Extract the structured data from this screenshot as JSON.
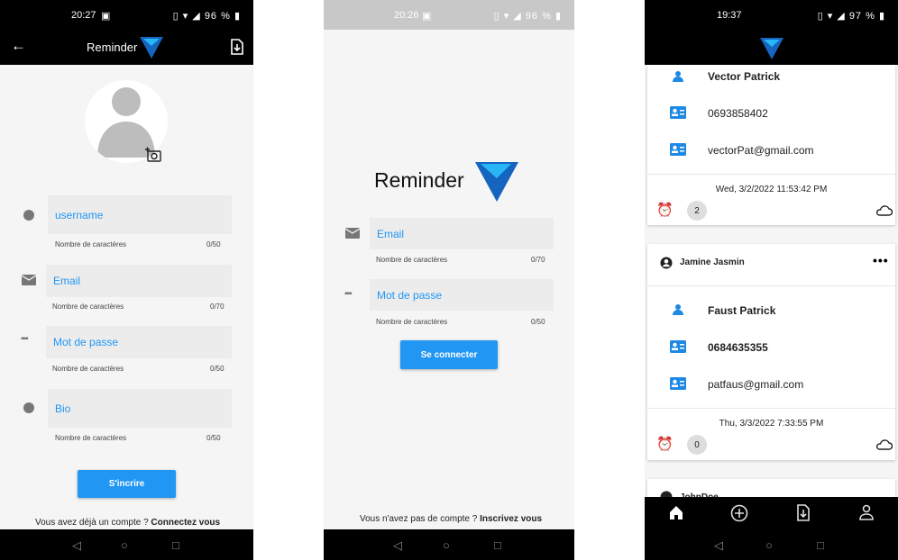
{
  "colors": {
    "accent": "#2196f3",
    "logo_dark": "#1565c0",
    "logo_light": "#29b6f6",
    "bar": "#000000"
  },
  "signup": {
    "status_time": "20:27",
    "status_battery": "96 %",
    "title": "Reminder",
    "fields": [
      {
        "placeholder": "username",
        "hint": "Nombre de caractères",
        "counter": "0/50"
      },
      {
        "placeholder": "Email",
        "hint": "Nombre de caractères",
        "counter": "0/70"
      },
      {
        "placeholder": "Mot de passe",
        "hint": "Nombre de caractères",
        "counter": "0/50"
      },
      {
        "placeholder": "Bio",
        "hint": "Nombre de caractères",
        "counter": "0/50"
      }
    ],
    "submit_label": "S'incrire",
    "footer_text": "Vous avez déjà un compte ?",
    "footer_link": "Connectez vous"
  },
  "login": {
    "status_time": "20:26",
    "status_battery": "96 %",
    "logo_text": "Reminder",
    "fields": [
      {
        "placeholder": "Email",
        "hint": "Nombre de caractères",
        "counter": "0/70"
      },
      {
        "placeholder": "Mot de passe",
        "hint": "Nombre de caractères",
        "counter": "0/50"
      }
    ],
    "submit_label": "Se connecter",
    "footer_text": "Vous n'avez pas de compte ?",
    "footer_link": "Inscrivez vous"
  },
  "feed": {
    "status_time": "19:37",
    "status_battery": "97 %",
    "cards": [
      {
        "name": "Vector Patrick",
        "phone": "0693858402",
        "email": "vectorPat@gmail.com",
        "timestamp": "Wed, 3/2/2022 11:53:42 PM",
        "count": "2"
      },
      {
        "author": "Jamine Jasmin",
        "name": "Faust Patrick",
        "phone": "0684635355",
        "email": "patfaus@gmail.com",
        "timestamp": "Thu, 3/3/2022 7:33:55 PM",
        "count": "0"
      }
    ],
    "partial_author": "JohnDoe",
    "nav_icons": [
      "home-icon",
      "add-circle-icon",
      "download-icon",
      "person-icon"
    ]
  }
}
